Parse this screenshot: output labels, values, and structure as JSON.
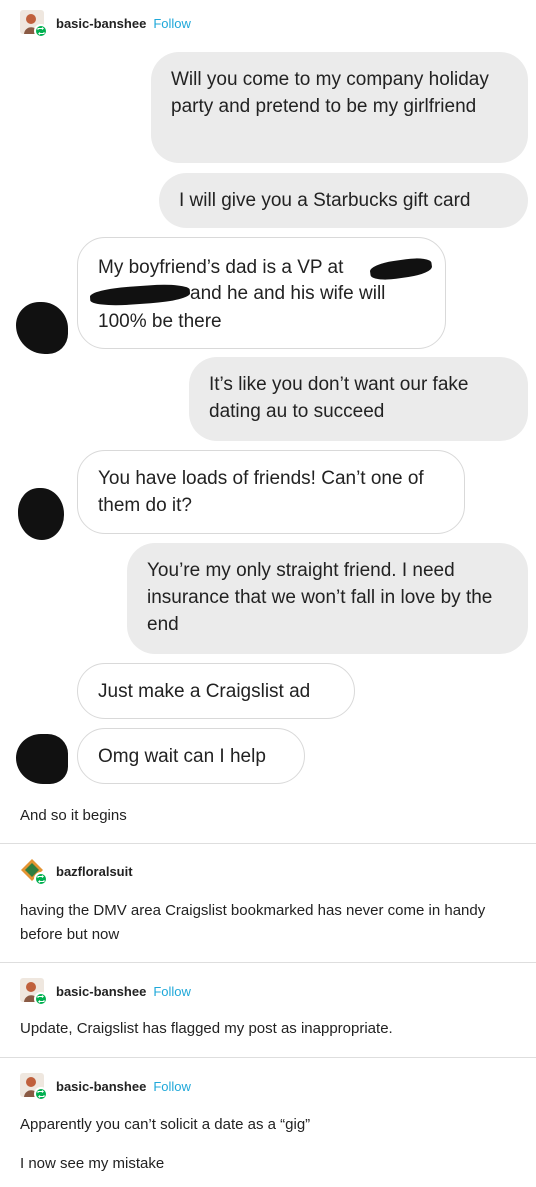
{
  "posts": [
    {
      "username": "basic-banshee",
      "follow": "Follow",
      "body": "And so it begins"
    },
    {
      "username": "bazfloralsuit",
      "body": "having the DMV area Craigslist bookmarked has never come in handy before but now"
    },
    {
      "username": "basic-banshee",
      "follow": "Follow",
      "body": "Update, Craigslist has flagged my post as inappropriate."
    },
    {
      "username": "basic-banshee",
      "follow": "Follow",
      "body": "Apparently you can’t solicit a date as a “gig”",
      "body2": "I now see my mistake"
    }
  ],
  "messages": [
    {
      "side": "right",
      "text": "Will you come to my company holiday party and pretend to be my girlfriend"
    },
    {
      "side": "right",
      "text": "I will give you a Starbucks gift card"
    },
    {
      "side": "left",
      "line1": "My boyfriend’s dad is a VP at",
      "line2": "and he and his wife will",
      "line3": "100% be there"
    },
    {
      "side": "right",
      "text": "It’s like you don’t want our fake dating au to succeed"
    },
    {
      "side": "left",
      "text": "You have loads of friends! Can’t one of them do it?"
    },
    {
      "side": "right",
      "text": "You’re my only straight friend. I need insurance that we won’t fall in love by the end"
    },
    {
      "side": "left",
      "text": "Just make a Craigslist ad"
    },
    {
      "side": "left",
      "text": "Omg wait can I help"
    }
  ],
  "colors": {
    "follow": "#1fa8d9",
    "reblog_badge": "#00b050",
    "right_bubble": "#ebebeb"
  }
}
